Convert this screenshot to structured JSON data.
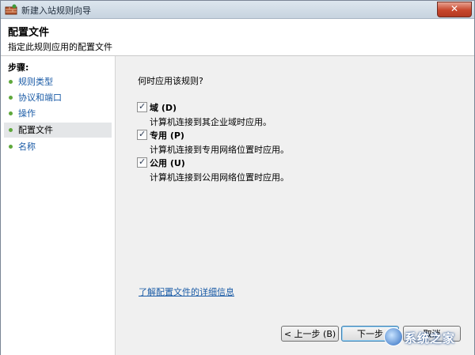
{
  "window": {
    "title": "新建入站规则向导",
    "close_glyph": "✕"
  },
  "header": {
    "title": "配置文件",
    "subtitle": "指定此规则应用的配置文件"
  },
  "steps": {
    "heading": "步骤:",
    "items": [
      {
        "label": "规则类型"
      },
      {
        "label": "协议和端口"
      },
      {
        "label": "操作"
      },
      {
        "label": "配置文件"
      },
      {
        "label": "名称"
      }
    ],
    "current_index": 3
  },
  "main": {
    "question": "何时应用该规则?",
    "options": [
      {
        "label": "域 (D)",
        "description": "计算机连接到其企业域时应用。",
        "checked": true
      },
      {
        "label": "专用 (P)",
        "description": "计算机连接到专用网络位置时应用。",
        "checked": true
      },
      {
        "label": "公用 (U)",
        "description": "计算机连接到公用网络位置时应用。",
        "checked": true
      }
    ],
    "learn_more_link": "了解配置文件的详细信息",
    "check_glyph": "✓"
  },
  "buttons": {
    "back": "< 上一步 (B)",
    "next": "下一步",
    "cancel": "取消"
  },
  "watermark": {
    "text": "系统之家"
  }
}
